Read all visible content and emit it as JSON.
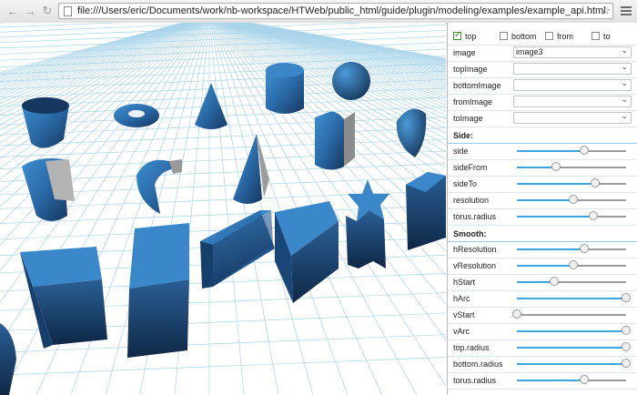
{
  "browser": {
    "url": "file:///Users/eric/Documents/work/nb-workspace/HTWeb/public_html/guide/plugin/modeling/examples/example_api.html"
  },
  "panel": {
    "checkboxes": [
      {
        "label": "top",
        "checked": true
      },
      {
        "label": "bottom",
        "checked": false
      },
      {
        "label": "from",
        "checked": false
      },
      {
        "label": "to",
        "checked": false
      }
    ],
    "selects": [
      {
        "label": "image",
        "value": "image3"
      },
      {
        "label": "topImage",
        "value": ""
      },
      {
        "label": "bottomImage",
        "value": ""
      },
      {
        "label": "fromImage",
        "value": ""
      },
      {
        "label": "toImage",
        "value": ""
      }
    ],
    "side_header": "Side:",
    "side_sliders": [
      {
        "label": "side",
        "value": 0.62
      },
      {
        "label": "sideFrom",
        "value": 0.36
      },
      {
        "label": "sideTo",
        "value": 0.72
      },
      {
        "label": "resolution",
        "value": 0.52
      },
      {
        "label": "torus.radius",
        "value": 0.7
      }
    ],
    "smooth_header": "Smooth:",
    "smooth_sliders": [
      {
        "label": "hResolution",
        "value": 0.62
      },
      {
        "label": "vResolution",
        "value": 0.52
      },
      {
        "label": "hStart",
        "value": 0.34
      },
      {
        "label": "hArc",
        "value": 1.0
      },
      {
        "label": "vStart",
        "value": 0.0
      },
      {
        "label": "vArc",
        "value": 1.0
      },
      {
        "label": "top.radius",
        "value": 1.0
      },
      {
        "label": "bottom.radius",
        "value": 1.0
      },
      {
        "label": "torus.radius",
        "value": 0.62
      }
    ]
  },
  "colors": {
    "accent": "#3ea3db",
    "shape_face": "#2f78b7",
    "shape_dark": "#1a3f6a",
    "grid": "#a9d4ea"
  }
}
